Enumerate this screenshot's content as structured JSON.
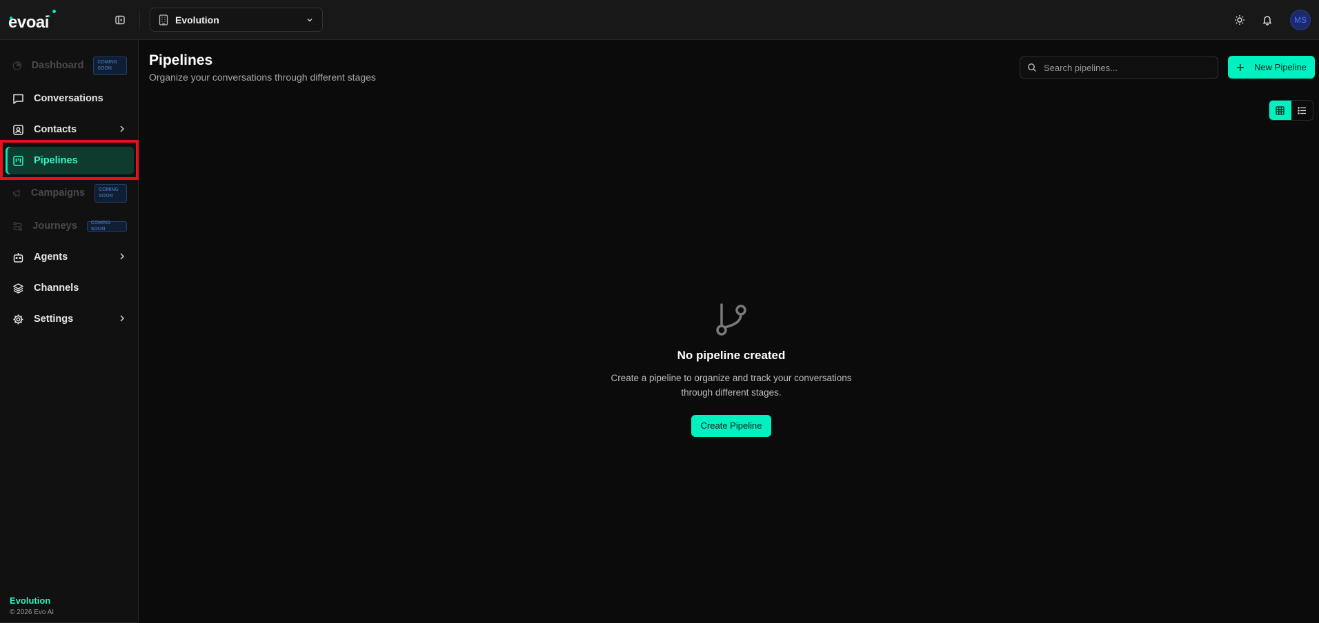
{
  "app": {
    "logo_text": "evo",
    "logo_text_ai": "ai",
    "accent": "#00f0c0"
  },
  "topbar": {
    "workspace": "Evolution",
    "user_initials": "MS",
    "icons": [
      "sidebar-toggle-icon",
      "building-icon",
      "chevron-down-icon",
      "sun-icon",
      "bell-icon"
    ]
  },
  "sidebar": {
    "items": [
      {
        "label": "Dashboard",
        "badge": "COMING SOON",
        "disabled": true,
        "icon": "pie-chart-icon"
      },
      {
        "label": "Conversations",
        "icon": "message-icon"
      },
      {
        "label": "Contacts",
        "icon": "contact-icon",
        "has_submenu": true
      },
      {
        "label": "Pipelines",
        "icon": "kanban-icon",
        "active": true
      },
      {
        "label": "Campaigns",
        "badge": "COMING SOON",
        "disabled": true,
        "icon": "megaphone-icon"
      },
      {
        "label": "Journeys",
        "badge": "COMING SOON",
        "disabled": true,
        "icon": "route-icon"
      },
      {
        "label": "Agents",
        "icon": "bot-icon",
        "has_submenu": true
      },
      {
        "label": "Channels",
        "icon": "layers-icon"
      },
      {
        "label": "Settings",
        "icon": "gear-icon",
        "has_submenu": true
      }
    ],
    "badge_line1": "COMING",
    "badge_line2": "SOON",
    "footer_org": "Evolution",
    "footer_copy": "© 2026 Evo AI"
  },
  "main": {
    "title": "Pipelines",
    "subtitle": "Organize your conversations through different stages",
    "search_placeholder": "Search pipelines...",
    "new_button": "New Pipeline",
    "view_modes": [
      "grid",
      "list"
    ],
    "active_view": "grid",
    "empty_title": "No pipeline created",
    "empty_desc": "Create a pipeline to organize and track your conversations through different stages.",
    "create_button": "Create Pipeline"
  }
}
